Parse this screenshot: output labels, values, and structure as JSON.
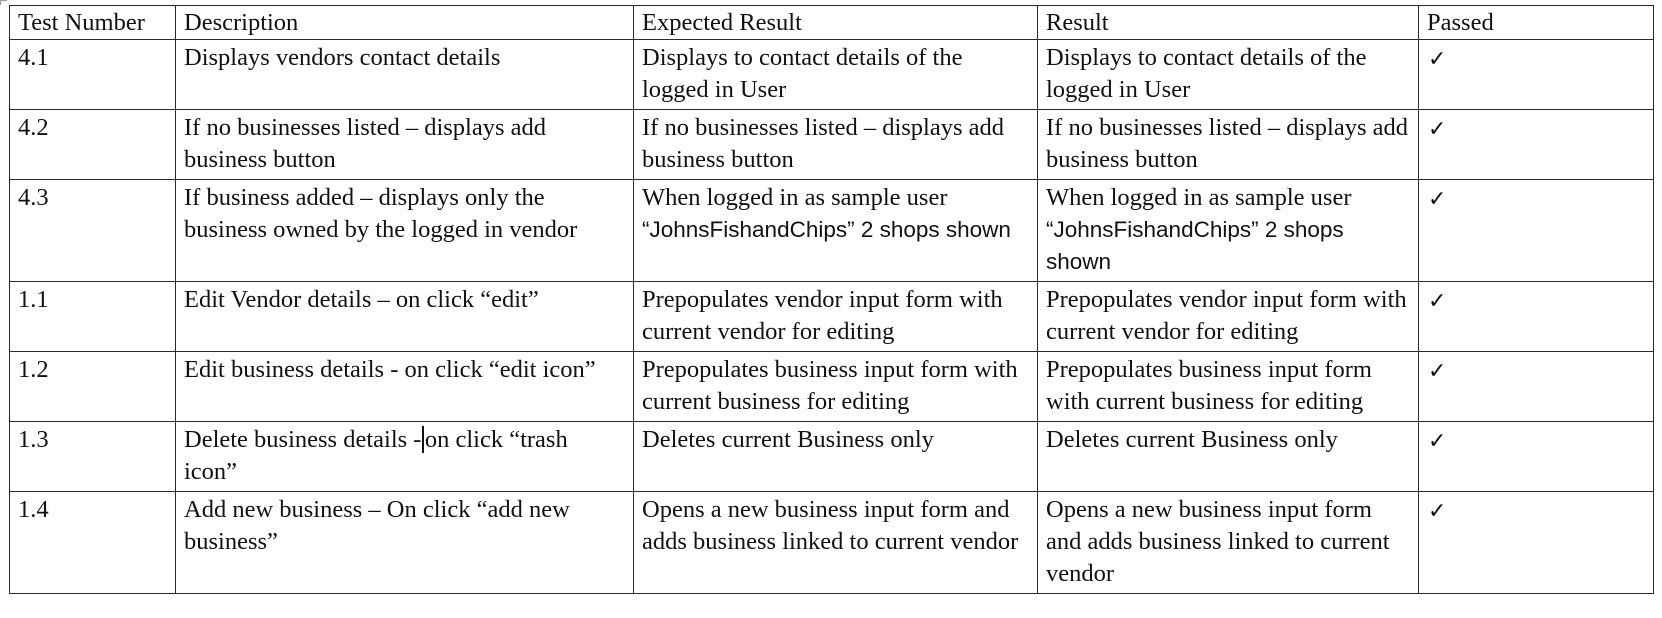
{
  "table": {
    "headers": {
      "test_number": "Test Number",
      "description": "Description",
      "expected_result": "Expected Result",
      "result": "Result",
      "passed": "Passed"
    },
    "rows": [
      {
        "test_number": "4.1",
        "description": "Displays vendors contact details",
        "expected_result": "Displays to contact details of the logged in User",
        "result": "Displays to contact details of the logged in User",
        "passed": "✓"
      },
      {
        "test_number": "4.2",
        "description": "If no businesses listed – displays add business button",
        "expected_result": "If no businesses listed – displays add business button",
        "result": "If no businesses listed – displays add business button",
        "passed": "✓"
      },
      {
        "test_number": "4.3",
        "description": "If business added – displays only the business owned by the logged in vendor",
        "expected_result_prefix": "When logged in as sample user ",
        "expected_result_sans": "“JohnsFishandChips” 2 shops shown",
        "result_prefix": "When logged in as sample user ",
        "result_sans": "“JohnsFishandChips” 2 shops shown",
        "passed": "✓"
      },
      {
        "test_number": "1.1",
        "description": "Edit Vendor details – on click “edit”",
        "expected_result": "Prepopulates vendor input form with current vendor for editing",
        "result": "Prepopulates vendor input form with current vendor for editing",
        "passed": "✓"
      },
      {
        "test_number": "1.2",
        "description": "Edit business details - on click “edit icon”",
        "expected_result": "Prepopulates business input form with current business for editing",
        "result": "Prepopulates business input form with current business for editing",
        "passed": "✓"
      },
      {
        "test_number": "1.3",
        "description_before_caret": "Delete business details -",
        "description_after_caret": "on click “trash icon”",
        "expected_result": "Deletes current Business only",
        "result": "Deletes current Business only",
        "passed": "✓"
      },
      {
        "test_number": "1.4",
        "description": "Add new business – On click “add new business”",
        "expected_result": "Opens a new business input form and adds business linked to current vendor",
        "result": "Opens a new business input form and adds business linked to current vendor",
        "passed": "✓"
      }
    ]
  }
}
